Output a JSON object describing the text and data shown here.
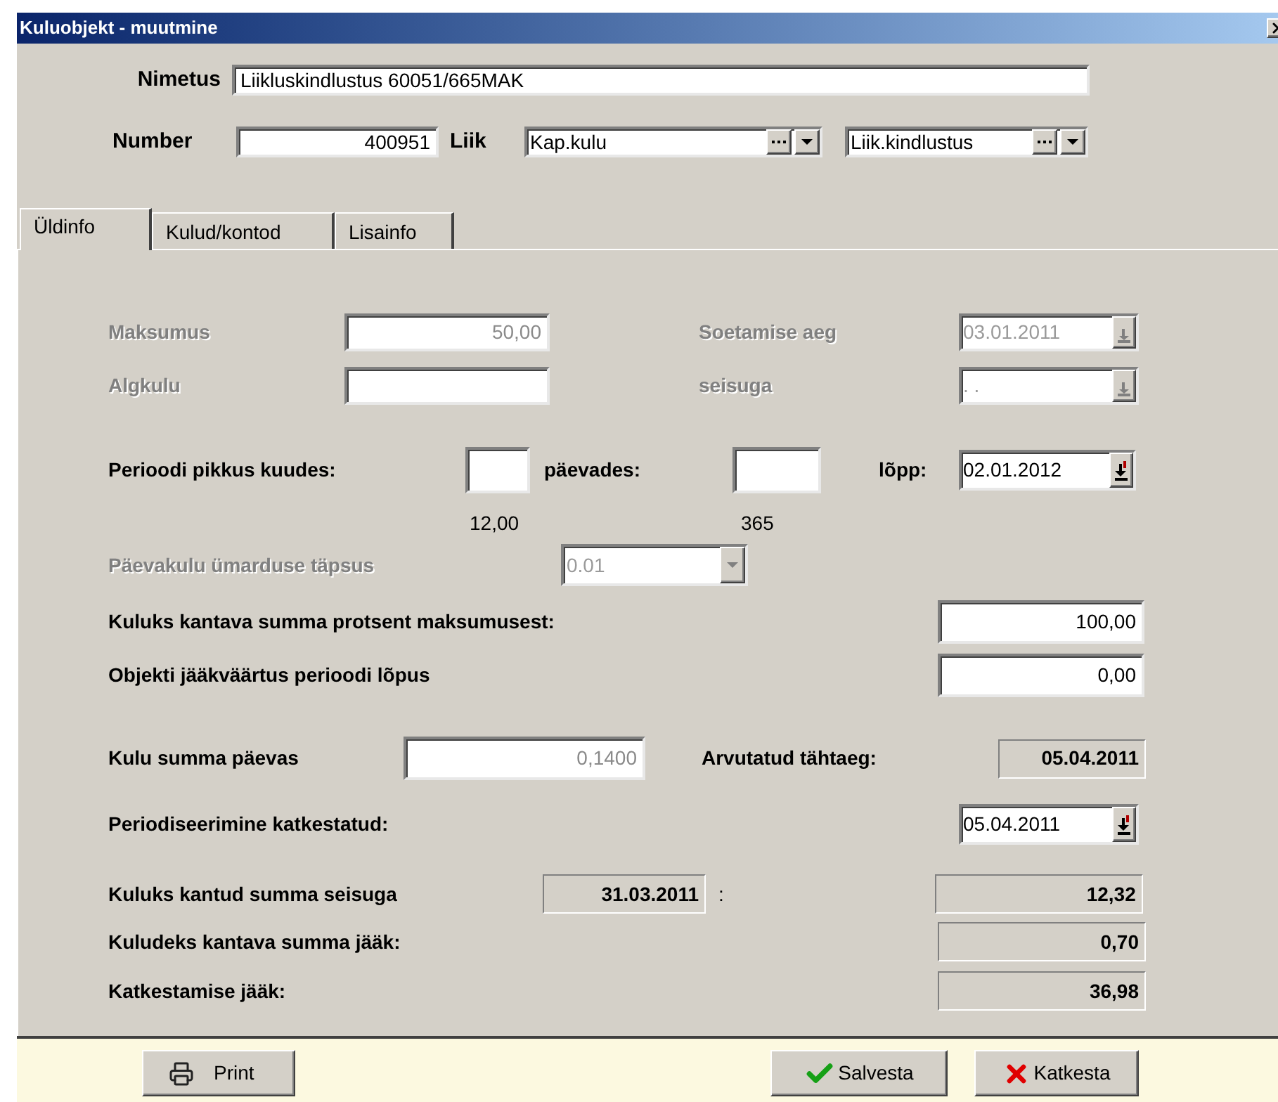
{
  "window": {
    "title": "Kuluobjekt - muutmine"
  },
  "header": {
    "name_label": "Nimetus",
    "name_value": "Liikluskindlustus 60051/665MAK",
    "number_label": "Number",
    "number_value": "400951",
    "type_label": "Liik",
    "type_value": "Kap.kulu",
    "subtype_value": "Liik.kindlustus"
  },
  "tabs": [
    {
      "label": "Üldinfo",
      "selected": true
    },
    {
      "label": "Kulud/kontod",
      "selected": false
    },
    {
      "label": "Lisainfo",
      "selected": false
    }
  ],
  "general": {
    "cost": {
      "label": "Maksumus",
      "value": "50,00",
      "disabled": true
    },
    "acquired": {
      "label": "Soetamise aeg",
      "value": "03.01.2011",
      "disabled": true
    },
    "initial": {
      "label": "Algkulu",
      "disabled": true
    },
    "as_of": {
      "label": "seisuga",
      "value": ". .",
      "disabled": true
    },
    "period": {
      "label": "Perioodi pikkus kuudes:",
      "months_hint": "12,00",
      "days_label": "päevades:",
      "days_hint": "365",
      "end_label": "lõpp:",
      "end_value": "02.01.2012"
    },
    "rounding": {
      "label": "Päevakulu ümarduse täpsus",
      "value": "0.01",
      "disabled": true
    },
    "percent": {
      "label": "Kuluks kantava summa protsent maksumusest:",
      "value": "100,00"
    },
    "residual": {
      "label": "Objekti jääkväärtus perioodi lõpus",
      "value": "0,00"
    },
    "daily": {
      "label": "Kulu summa päevas",
      "value": "0,1400",
      "disabled": true
    },
    "computed_due": {
      "label": "Arvutatud tähtaeg:",
      "value": "05.04.2011"
    },
    "interrupted": {
      "label": "Periodiseerimine katkestatud:",
      "value": "05.04.2011"
    },
    "expensed": {
      "label": "Kuluks kantud summa seisuga",
      "date": "31.03.2011",
      "colon": ":",
      "value": "12,32"
    },
    "remaining": {
      "label": "Kuludeks kantava summa jääk:",
      "value": "0,70"
    },
    "interrupt_rest": {
      "label": "Katkestamise jääk:",
      "value": "36,98"
    }
  },
  "footer_buttons": [
    {
      "kind": "print",
      "label": "Print"
    },
    {
      "kind": "save",
      "label": "Salvesta"
    },
    {
      "kind": "cancel",
      "label": "Katkesta"
    }
  ]
}
